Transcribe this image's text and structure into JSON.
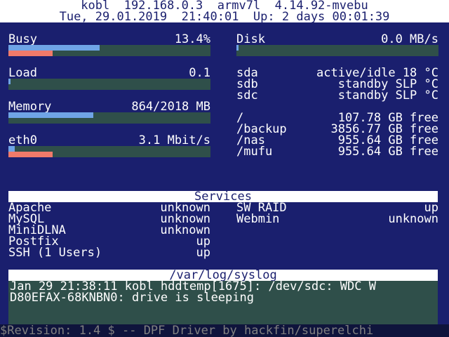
{
  "colors": {
    "background": "#1a1f6e",
    "header_bg": "#ffffff",
    "bar_track": "#2f4f4a",
    "bar_fill_primary": "#6fa4e6",
    "bar_fill_secondary": "#f07a6a",
    "footer_text": "#808080"
  },
  "header": {
    "line1": "kobl  192.168.0.3  armv7l  4.14.92-mvebu",
    "line2": "Tue, 29.01.2019  21:40:01  Up: 2 days 00:01:39"
  },
  "stats": [
    {
      "label": "Busy",
      "value": "13.4%",
      "fill_primary": 0.45,
      "fill_secondary": 0.22
    },
    {
      "label": "Load",
      "value": "0.1",
      "fill_primary": 0.01,
      "fill_secondary": 0
    },
    {
      "label": "Memory",
      "value": "864/2018 MB",
      "fill_primary": 0.42,
      "fill_secondary": 0
    },
    {
      "label": "eth0",
      "value": "3.1 Mbit/s",
      "fill_primary": 0.03,
      "fill_secondary": 0.22
    }
  ],
  "disk": {
    "label": "Disk",
    "value": "0.0 MB/s",
    "fill_primary": 0.01,
    "fill_secondary": 0
  },
  "drives": [
    {
      "name": "sda",
      "status": "active/idle 18 °C"
    },
    {
      "name": "sdb",
      "status": "standby SLP °C"
    },
    {
      "name": "sdc",
      "status": "standby SLP °C"
    }
  ],
  "mounts": [
    {
      "path": "/",
      "free": "107.78 GB free"
    },
    {
      "path": "/backup",
      "free": "3856.77 GB free"
    },
    {
      "path": "/nas",
      "free": "955.64 GB free"
    },
    {
      "path": "/mufu",
      "free": "955.64 GB free"
    }
  ],
  "services": {
    "title": "Services",
    "left": [
      {
        "name": "Apache",
        "status": "unknown"
      },
      {
        "name": "MySQL",
        "status": "unknown"
      },
      {
        "name": "MiniDLNA",
        "status": "unknown"
      },
      {
        "name": "Postfix",
        "status": "up"
      },
      {
        "name": "SSH (1 Users)",
        "status": "up"
      }
    ],
    "right": [
      {
        "name": "SW RAID",
        "status": "up"
      },
      {
        "name": "Webmin",
        "status": "unknown"
      }
    ]
  },
  "syslog": {
    "title": "/var/log/syslog",
    "line1": "Jan 29 21:38:11 kobl hddtemp[1675]: /dev/sdc: WDC W",
    "line2": "D80EFAX-68KNBN0: drive is sleeping"
  },
  "footer": "$Revision: 1.4 $ -- DPF Driver by hackfin/superelchi"
}
